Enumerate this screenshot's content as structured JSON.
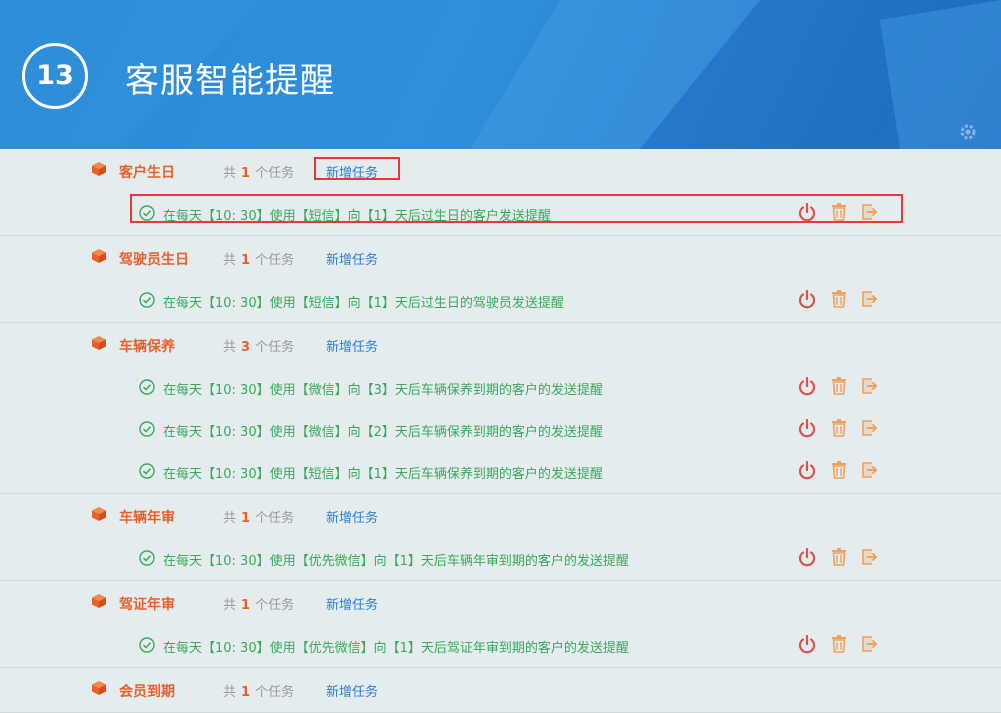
{
  "header": {
    "step_number": "13",
    "title": "客服智能提醒",
    "icon": "gear-icon"
  },
  "sections": [
    {
      "name": "客户生日",
      "count_prefix": "共",
      "count": "1",
      "count_suffix": "个任务",
      "add_label": "新增任务",
      "tasks": [
        {
          "text": "在每天【10: 30】使用【短信】向【1】天后过生日的客户发送提醒"
        }
      ]
    },
    {
      "name": "驾驶员生日",
      "count_prefix": "共",
      "count": "1",
      "count_suffix": "个任务",
      "add_label": "新增任务",
      "tasks": [
        {
          "text": "在每天【10: 30】使用【短信】向【1】天后过生日的驾驶员发送提醒"
        }
      ]
    },
    {
      "name": "车辆保养",
      "count_prefix": "共",
      "count": "3",
      "count_suffix": "个任务",
      "add_label": "新增任务",
      "tasks": [
        {
          "text": "在每天【10: 30】使用【微信】向【3】天后车辆保养到期的客户的发送提醒"
        },
        {
          "text": "在每天【10: 30】使用【微信】向【2】天后车辆保养到期的客户的发送提醒"
        },
        {
          "text": "在每天【10: 30】使用【短信】向【1】天后车辆保养到期的客户的发送提醒"
        }
      ]
    },
    {
      "name": "车辆年审",
      "count_prefix": "共",
      "count": "1",
      "count_suffix": "个任务",
      "add_label": "新增任务",
      "tasks": [
        {
          "text": "在每天【10: 30】使用【优先微信】向【1】天后车辆年审到期的客户的发送提醒"
        }
      ]
    },
    {
      "name": "驾证年审",
      "count_prefix": "共",
      "count": "1",
      "count_suffix": "个任务",
      "add_label": "新增任务",
      "tasks": [
        {
          "text": "在每天【10: 30】使用【优先微信】向【1】天后驾证年审到期的客户的发送提醒"
        }
      ]
    },
    {
      "name": "会员到期",
      "count_prefix": "共",
      "count": "1",
      "count_suffix": "个任务",
      "add_label": "新增任务",
      "tasks": []
    }
  ],
  "colors": {
    "header_blue": "#2a8ad6",
    "section_title": "#e8612c",
    "task_text": "#3aa85a",
    "link": "#2a7fd0",
    "power_icon": "#d9534f",
    "trash_icon": "#f0a05a",
    "exit_icon": "#f0a05a",
    "highlight": "#e03a3a"
  },
  "task_icons": [
    "check-circle-icon",
    "power-icon",
    "trash-icon",
    "exit-icon"
  ]
}
